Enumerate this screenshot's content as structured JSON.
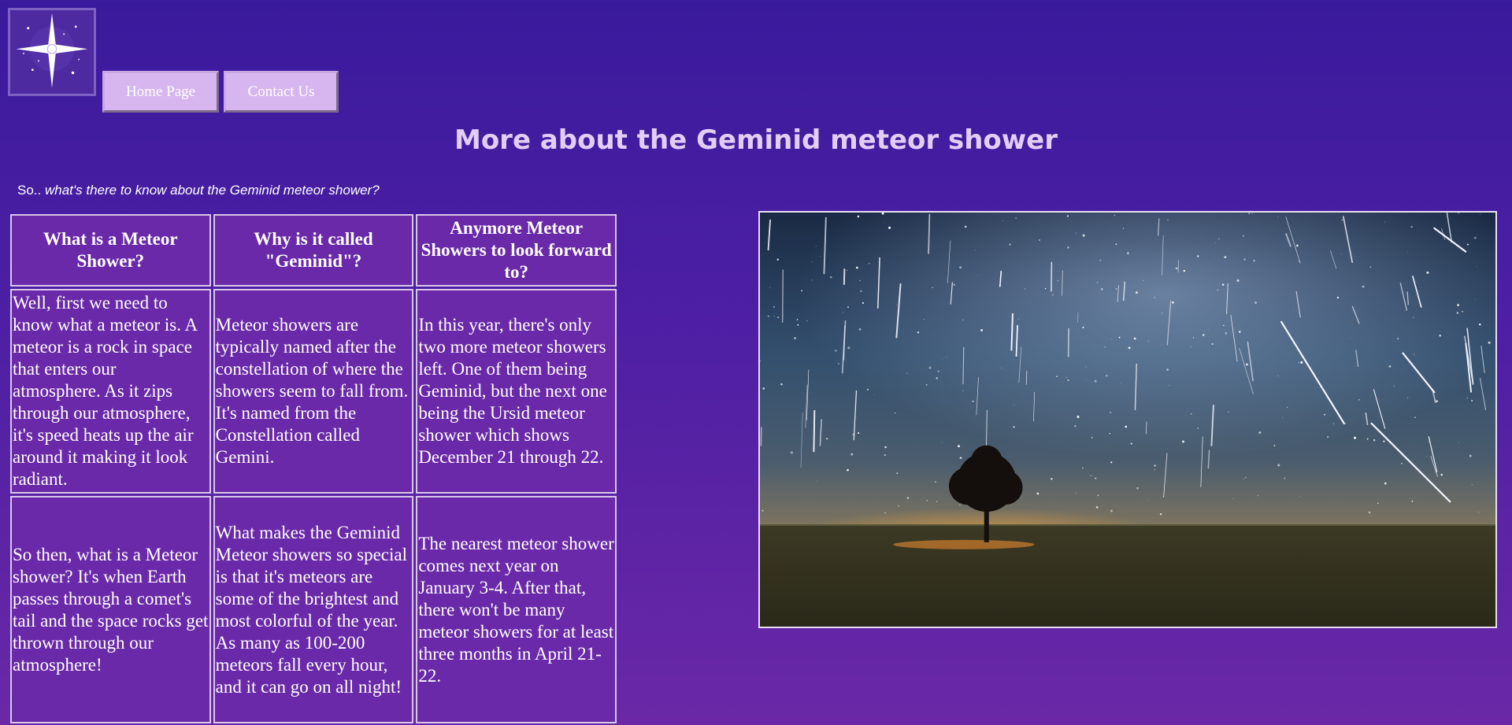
{
  "header": {
    "logo_icon": "four-point-star-logo-icon",
    "nav": {
      "home_label": "Home Page",
      "contact_label": "Contact Us"
    }
  },
  "main": {
    "title": "More about the Geminid meteor shower",
    "intro_prefix": "So..",
    "intro_emphasis": "what's there to know about the Geminid meteor shower?",
    "table": {
      "headers": [
        "What is a Meteor Shower?",
        "Why is it called \"Geminid\"?",
        "Anymore Meteor Showers to look forward to?"
      ],
      "rows": [
        [
          "Well, first we need to know what a meteor is. A meteor is a rock in space that enters our atmosphere. As it zips through our atmosphere, it's speed heats up the air around it making it look radiant.",
          "Meteor showers are typically named after the constellation of where the showers seem to fall from. It's named from the Constellation called Gemini.",
          "In this year, there's only two more meteor showers left. One of them being Geminid, but the next one being the Ursid meteor shower which shows December 21 through 22."
        ],
        [
          "So then, what is a Meteor shower? It's when Earth passes through a comet's tail and the space rocks get thrown through our atmosphere!",
          "What makes the Geminid Meteor showers so special is that it's meteors are some of the brightest and most colorful of the year. As many as 100-200 meteors fall every hour, and it can go on all night!",
          "The nearest meteor shower comes next year on January 3-4. After that, there won't be many meteor showers for at least three months in April 21-22."
        ]
      ]
    },
    "photo_icon": "meteor-shower-night-sky-photo"
  }
}
